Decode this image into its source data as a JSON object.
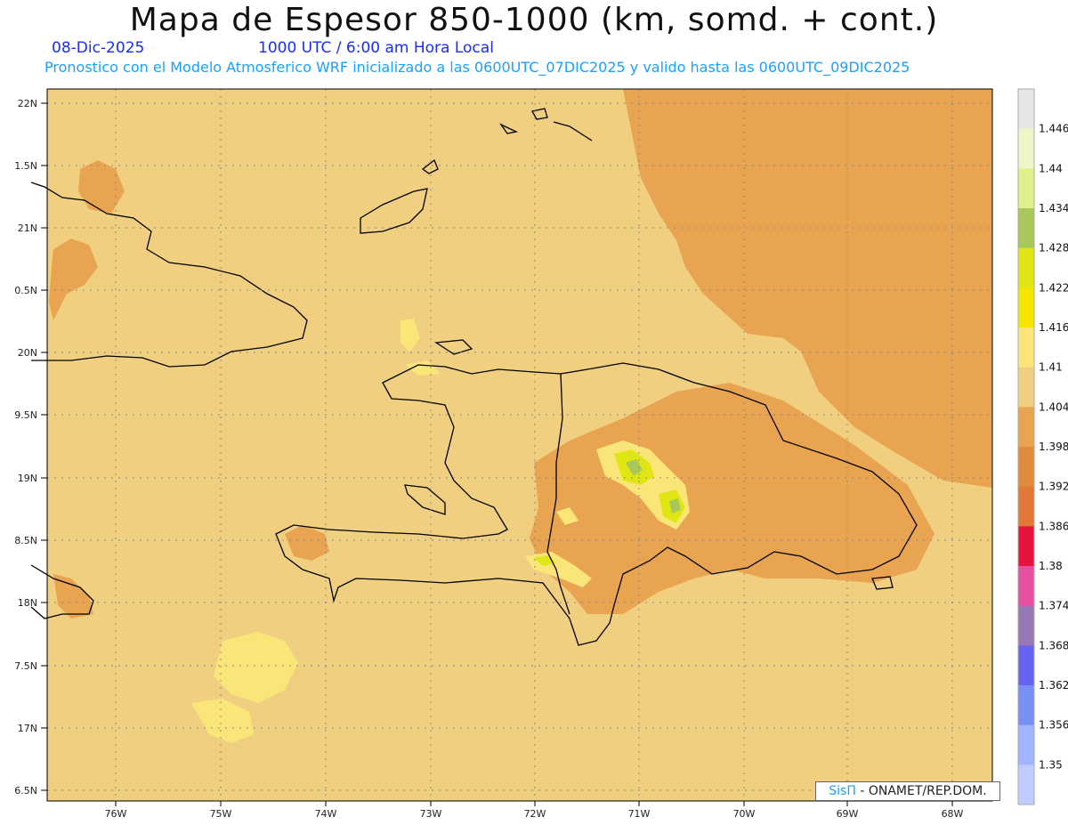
{
  "header": {
    "title": "Mapa de Espesor 850-1000 (km, somd. + cont.)",
    "date": "08-Dic-2025",
    "time": "1000 UTC / 6:00 am Hora Local",
    "forecast": "Pronostico con el Modelo Atmosferico WRF inicializado a las 0600UTC_07DIC2025 y valido hasta las  0600UTC_09DIC2025"
  },
  "axes": {
    "lat_labels": [
      "22N",
      "1.5N",
      "21N",
      "0.5N",
      "20N",
      "9.5N",
      "19N",
      "8.5N",
      "18N",
      "7.5N",
      "17N",
      "6.5N"
    ],
    "lon_labels": [
      "76W",
      "75W",
      "74W",
      "73W",
      "72W",
      "71W",
      "70W",
      "69W",
      "68W"
    ]
  },
  "colorbar": {
    "levels": [
      "1.446",
      "1.44",
      "1.434",
      "1.428",
      "1.422",
      "1.416",
      "1.41",
      "1.404",
      "1.398",
      "1.392",
      "1.386",
      "1.38",
      "1.374",
      "1.368",
      "1.362",
      "1.356",
      "1.35"
    ],
    "colors": [
      "#e6e6e6",
      "#f0f5c8",
      "#e0f08c",
      "#a8c85a",
      "#e0e614",
      "#f5e600",
      "#fae678",
      "#f0d080",
      "#e8a450",
      "#e08c3c",
      "#e07838",
      "#e6143c",
      "#e650a0",
      "#9678b4",
      "#6464f0",
      "#7890f5",
      "#a0b4ff",
      "#c0ccff"
    ]
  },
  "map_colors": {
    "base": "#f0d080",
    "warm": "#e8a450",
    "light": "#fae678",
    "yellow": "#e0e614",
    "green": "#a8c85a"
  },
  "credit": {
    "brand": "SisΠ",
    "text": "- ONAMET/REP.DOM."
  }
}
